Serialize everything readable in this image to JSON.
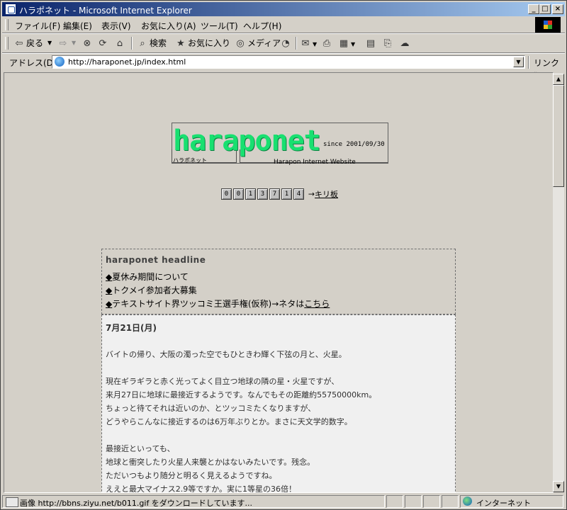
{
  "window": {
    "title": "ハラポネット - Microsoft Internet Explorer",
    "min_label": "_",
    "max_label": "□",
    "close_label": "×"
  },
  "menu": [
    "ファイル(F)",
    "編集(E)",
    "表示(V)",
    "お気に入り(A)",
    "ツール(T)",
    "ヘルプ(H)"
  ],
  "toolbar": {
    "back": "戻る",
    "search": "検索",
    "favorites": "お気に入り",
    "media": "メディア"
  },
  "address": {
    "label": "アドレス(D)",
    "url": "http://haraponet.jp/index.html",
    "links": "リンク »"
  },
  "logo": {
    "wordmark": "haraponet",
    "since": "since 2001/09/30",
    "small": "ハラポネット",
    "site": "Harapon Internet Website"
  },
  "counter": {
    "digits": [
      "0",
      "0",
      "1",
      "3",
      "7",
      "1",
      "4"
    ],
    "arrow": "→",
    "kiri_label": "キリ板"
  },
  "headline": {
    "title": "haraponet headline",
    "items": [
      {
        "bullet": "◆",
        "text": "夏休み期間について"
      },
      {
        "bullet": "◆",
        "text": "トクメイ参加者大募集"
      },
      {
        "bullet": "◆",
        "text": "テキストサイト界ツッコミ王選手権(仮称)→ネタは",
        "link": "こちら"
      }
    ]
  },
  "diary": {
    "date": "7月21日(月)",
    "lines": [
      "バイトの帰り、大阪の濁った空でもひときわ輝く下弦の月と、火星。",
      "現在ギラギラと赤く光ってよく目立つ地球の隣の星・火星ですが、",
      "来月27日に地球に最接近するようです。なんでもその距離約55750000km。",
      "ちょっと待てそれは近いのか、とツッコミたくなりますが、",
      "どうやらこんなに接近するのは6万年ぶりとか。まさに天文学的数字。",
      "最接近といっても、",
      "地球と衝突したり火星人来襲とかはないみたいです。残念。",
      "ただいつもより随分と明るく見えるようですね。",
      "ええと最大マイナス2.9等ですか。実に1等星の36倍！"
    ]
  },
  "status": {
    "message": "画像 http://bbns.ziyu.net/b011.gif をダウンロードしています...",
    "zone": "インターネット"
  }
}
